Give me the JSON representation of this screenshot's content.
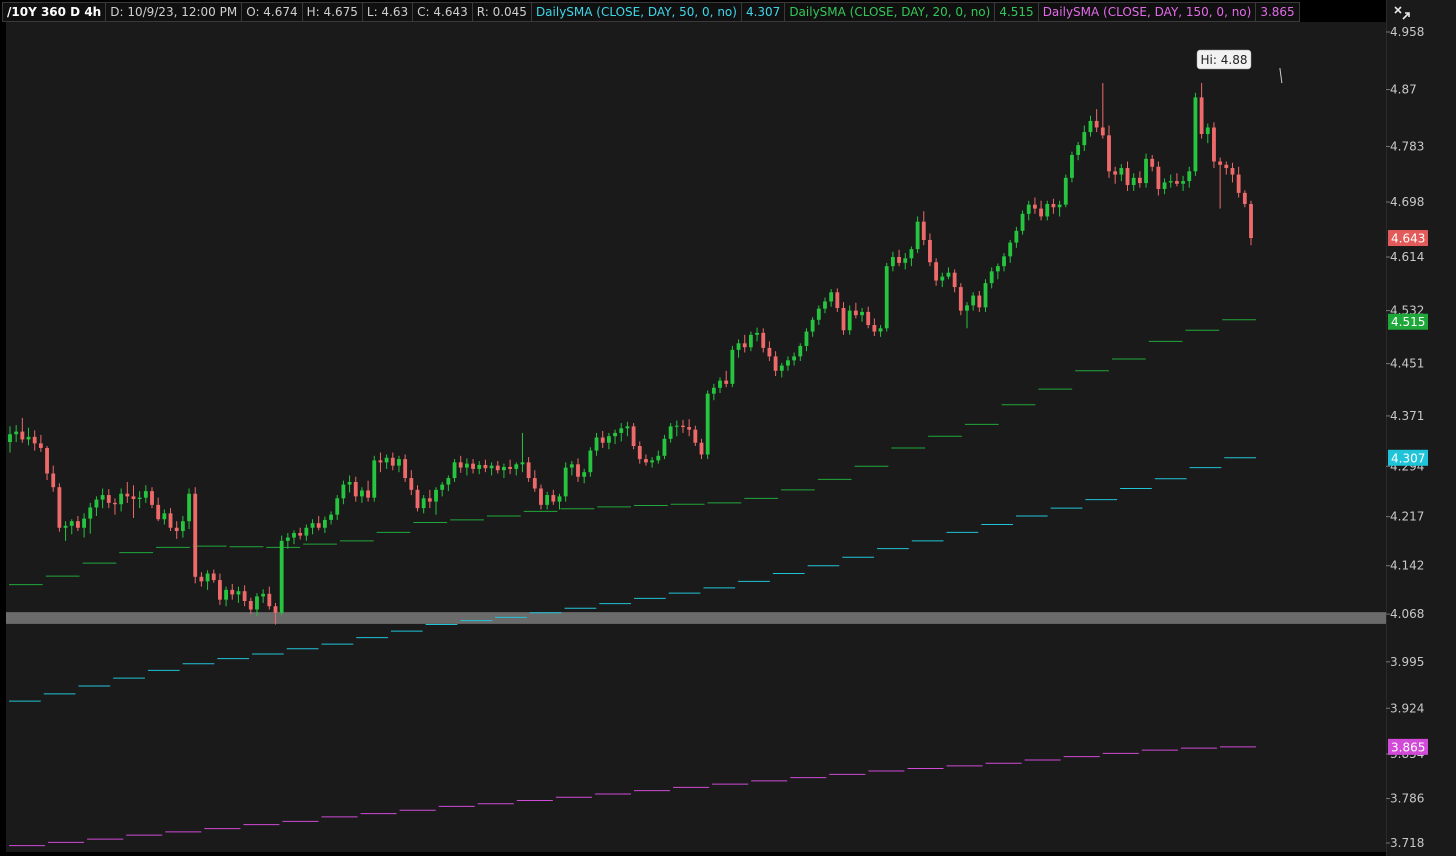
{
  "header": {
    "symbol": "/10Y 360 D 4h",
    "date": "D: 10/9/23, 12:00 PM",
    "open": "O: 4.674",
    "high": "H: 4.675",
    "low": "L: 4.63",
    "close": "C: 4.643",
    "range": "R: 0.045",
    "sma50_label": "DailySMA (CLOSE, DAY, 50, 0, no)",
    "sma50_value": "4.307",
    "sma20_label": "DailySMA (CLOSE, DAY, 20, 0, no)",
    "sma20_value": "4.515",
    "sma150_label": "DailySMA (CLOSE, DAY, 150, 0, no)",
    "sma150_value": "3.865"
  },
  "chart_data": {
    "type": "candlestick",
    "ylim": [
      3.7,
      4.99
    ],
    "y_ticks": [
      "4.958",
      "4.87",
      "4.783",
      "4.698",
      "4.614",
      "4.532",
      "4.451",
      "4.371",
      "4.294",
      "4.217",
      "4.142",
      "4.068",
      "3.995",
      "3.924",
      "3.854",
      "3.786",
      "3.718"
    ],
    "price_tags": [
      {
        "value": 4.643,
        "label": "4.643",
        "color": "#e25a5a"
      },
      {
        "value": 4.515,
        "label": "4.515",
        "color": "#1fa83a"
      },
      {
        "value": 4.307,
        "label": "4.307",
        "color": "#20c4d8"
      },
      {
        "value": 3.865,
        "label": "3.865",
        "color": "#d24ad8"
      }
    ],
    "annotation": {
      "text": "Hi: 4.88",
      "value": 4.88,
      "bar": 206
    },
    "support_band": [
      4.053,
      4.071
    ],
    "candles": [
      [
        4.331,
        4.355,
        4.315,
        4.343
      ],
      [
        4.343,
        4.357,
        4.331,
        4.347
      ],
      [
        4.347,
        4.368,
        4.33,
        4.335
      ],
      [
        4.335,
        4.353,
        4.326,
        4.339
      ],
      [
        4.339,
        4.349,
        4.318,
        4.329
      ],
      [
        4.329,
        4.342,
        4.316,
        4.322
      ],
      [
        4.322,
        4.325,
        4.273,
        4.283
      ],
      [
        4.283,
        4.295,
        4.255,
        4.262
      ],
      [
        4.262,
        4.268,
        4.194,
        4.2
      ],
      [
        4.2,
        4.21,
        4.18,
        4.203
      ],
      [
        4.203,
        4.213,
        4.19,
        4.21
      ],
      [
        4.21,
        4.218,
        4.195,
        4.2
      ],
      [
        4.2,
        4.222,
        4.185,
        4.214
      ],
      [
        4.214,
        4.238,
        4.191,
        4.231
      ],
      [
        4.231,
        4.248,
        4.218,
        4.243
      ],
      [
        4.243,
        4.26,
        4.23,
        4.25
      ],
      [
        4.25,
        4.259,
        4.23,
        4.238
      ],
      [
        4.238,
        4.245,
        4.22,
        4.236
      ],
      [
        4.236,
        4.26,
        4.225,
        4.252
      ],
      [
        4.252,
        4.27,
        4.238,
        4.248
      ],
      [
        4.248,
        4.265,
        4.215,
        4.244
      ],
      [
        4.244,
        4.256,
        4.23,
        4.246
      ],
      [
        4.246,
        4.265,
        4.238,
        4.256
      ],
      [
        4.256,
        4.262,
        4.23,
        4.235
      ],
      [
        4.235,
        4.246,
        4.21,
        4.213
      ],
      [
        4.213,
        4.228,
        4.205,
        4.222
      ],
      [
        4.222,
        4.23,
        4.195,
        4.2
      ],
      [
        4.2,
        4.21,
        4.183,
        4.195
      ],
      [
        4.195,
        4.218,
        4.185,
        4.21
      ],
      [
        4.21,
        4.26,
        4.198,
        4.252
      ],
      [
        4.252,
        4.262,
        4.115,
        4.125
      ],
      [
        4.125,
        4.132,
        4.11,
        4.118
      ],
      [
        4.118,
        4.135,
        4.105,
        4.13
      ],
      [
        4.13,
        4.136,
        4.116,
        4.12
      ],
      [
        4.12,
        4.13,
        4.082,
        4.09
      ],
      [
        4.09,
        4.11,
        4.08,
        4.105
      ],
      [
        4.105,
        4.114,
        4.09,
        4.098
      ],
      [
        4.098,
        4.11,
        4.085,
        4.103
      ],
      [
        4.103,
        4.112,
        4.08,
        4.088
      ],
      [
        4.088,
        4.093,
        4.068,
        4.075
      ],
      [
        4.075,
        4.1,
        4.065,
        4.095
      ],
      [
        4.095,
        4.106,
        4.085,
        4.099
      ],
      [
        4.099,
        4.11,
        4.075,
        4.08
      ],
      [
        4.08,
        4.085,
        4.052,
        4.07
      ],
      [
        4.07,
        4.188,
        4.066,
        4.18
      ],
      [
        4.18,
        4.192,
        4.168,
        4.185
      ],
      [
        4.185,
        4.196,
        4.175,
        4.192
      ],
      [
        4.192,
        4.2,
        4.182,
        4.188
      ],
      [
        4.188,
        4.205,
        4.18,
        4.2
      ],
      [
        4.2,
        4.213,
        4.19,
        4.207
      ],
      [
        4.207,
        4.218,
        4.196,
        4.2
      ],
      [
        4.2,
        4.217,
        4.192,
        4.212
      ],
      [
        4.212,
        4.225,
        4.205,
        4.22
      ],
      [
        4.22,
        4.25,
        4.212,
        4.245
      ],
      [
        4.245,
        4.272,
        4.236,
        4.266
      ],
      [
        4.266,
        4.28,
        4.254,
        4.27
      ],
      [
        4.27,
        4.278,
        4.24,
        4.248
      ],
      [
        4.248,
        4.262,
        4.238,
        4.257
      ],
      [
        4.257,
        4.272,
        4.24,
        4.246
      ],
      [
        4.246,
        4.31,
        4.24,
        4.303
      ],
      [
        4.303,
        4.315,
        4.285,
        4.3
      ],
      [
        4.3,
        4.312,
        4.29,
        4.307
      ],
      [
        4.307,
        4.315,
        4.288,
        4.295
      ],
      [
        4.295,
        4.31,
        4.285,
        4.305
      ],
      [
        4.305,
        4.312,
        4.27,
        4.276
      ],
      [
        4.276,
        4.288,
        4.25,
        4.258
      ],
      [
        4.258,
        4.265,
        4.225,
        4.23
      ],
      [
        4.23,
        4.25,
        4.222,
        4.245
      ],
      [
        4.245,
        4.258,
        4.23,
        4.24
      ],
      [
        4.24,
        4.262,
        4.22,
        4.258
      ],
      [
        4.258,
        4.27,
        4.248,
        4.266
      ],
      [
        4.266,
        4.28,
        4.256,
        4.276
      ],
      [
        4.276,
        4.305,
        4.27,
        4.3
      ],
      [
        4.3,
        4.31,
        4.284,
        4.292
      ],
      [
        4.292,
        4.306,
        4.28,
        4.298
      ],
      [
        4.298,
        4.305,
        4.283,
        4.29
      ],
      [
        4.29,
        4.302,
        4.282,
        4.296
      ],
      [
        4.296,
        4.304,
        4.285,
        4.291
      ],
      [
        4.291,
        4.3,
        4.28,
        4.295
      ],
      [
        4.295,
        4.302,
        4.283,
        4.288
      ],
      [
        4.288,
        4.298,
        4.276,
        4.293
      ],
      [
        4.293,
        4.304,
        4.282,
        4.29
      ],
      [
        4.29,
        4.3,
        4.28,
        4.297
      ],
      [
        4.297,
        4.345,
        4.285,
        4.3
      ],
      [
        4.3,
        4.308,
        4.27,
        4.276
      ],
      [
        4.276,
        4.288,
        4.255,
        4.26
      ],
      [
        4.26,
        4.266,
        4.228,
        4.235
      ],
      [
        4.235,
        4.255,
        4.228,
        4.25
      ],
      [
        4.25,
        4.258,
        4.235,
        4.24
      ],
      [
        4.24,
        4.252,
        4.228,
        4.248
      ],
      [
        4.248,
        4.3,
        4.24,
        4.292
      ],
      [
        4.292,
        4.302,
        4.28,
        4.297
      ],
      [
        4.297,
        4.306,
        4.27,
        4.278
      ],
      [
        4.278,
        4.29,
        4.268,
        4.285
      ],
      [
        4.285,
        4.323,
        4.278,
        4.318
      ],
      [
        4.318,
        4.345,
        4.31,
        4.338
      ],
      [
        4.338,
        4.348,
        4.322,
        4.33
      ],
      [
        4.33,
        4.345,
        4.32,
        4.34
      ],
      [
        4.34,
        4.35,
        4.328,
        4.345
      ],
      [
        4.345,
        4.36,
        4.332,
        4.352
      ],
      [
        4.352,
        4.362,
        4.34,
        4.355
      ],
      [
        4.355,
        4.36,
        4.32,
        4.325
      ],
      [
        4.325,
        4.332,
        4.298,
        4.305
      ],
      [
        4.305,
        4.312,
        4.295,
        4.3
      ],
      [
        4.3,
        4.308,
        4.292,
        4.303
      ],
      [
        4.303,
        4.318,
        4.298,
        4.31
      ],
      [
        4.31,
        4.342,
        4.305,
        4.336
      ],
      [
        4.336,
        4.36,
        4.33,
        4.355
      ],
      [
        4.355,
        4.364,
        4.34,
        4.356
      ],
      [
        4.356,
        4.365,
        4.345,
        4.354
      ],
      [
        4.354,
        4.366,
        4.34,
        4.35
      ],
      [
        4.35,
        4.356,
        4.325,
        4.33
      ],
      [
        4.33,
        4.336,
        4.305,
        4.312
      ],
      [
        4.312,
        4.41,
        4.305,
        4.405
      ],
      [
        4.405,
        4.42,
        4.395,
        4.414
      ],
      [
        4.414,
        4.43,
        4.406,
        4.425
      ],
      [
        4.425,
        4.44,
        4.415,
        4.42
      ],
      [
        4.42,
        4.478,
        4.415,
        4.472
      ],
      [
        4.472,
        4.488,
        4.46,
        4.482
      ],
      [
        4.482,
        4.495,
        4.468,
        4.476
      ],
      [
        4.476,
        4.5,
        4.47,
        4.495
      ],
      [
        4.495,
        4.506,
        4.485,
        4.498
      ],
      [
        4.498,
        4.505,
        4.468,
        4.475
      ],
      [
        4.475,
        4.485,
        4.455,
        4.462
      ],
      [
        4.462,
        4.47,
        4.432,
        4.44
      ],
      [
        4.44,
        4.452,
        4.43,
        4.448
      ],
      [
        4.448,
        4.462,
        4.44,
        4.456
      ],
      [
        4.456,
        4.468,
        4.448,
        4.462
      ],
      [
        4.462,
        4.482,
        4.455,
        4.478
      ],
      [
        4.478,
        4.505,
        4.47,
        4.5
      ],
      [
        4.5,
        4.522,
        4.492,
        4.518
      ],
      [
        4.518,
        4.54,
        4.51,
        4.535
      ],
      [
        4.535,
        4.552,
        4.528,
        4.546
      ],
      [
        4.546,
        4.565,
        4.538,
        4.56
      ],
      [
        4.56,
        4.566,
        4.53,
        4.536
      ],
      [
        4.536,
        4.545,
        4.495,
        4.502
      ],
      [
        4.502,
        4.54,
        4.495,
        4.532
      ],
      [
        4.532,
        4.544,
        4.52,
        4.525
      ],
      [
        4.525,
        4.536,
        4.515,
        4.53
      ],
      [
        4.53,
        4.538,
        4.505,
        4.51
      ],
      [
        4.51,
        4.52,
        4.493,
        4.5
      ],
      [
        4.5,
        4.51,
        4.492,
        4.505
      ],
      [
        4.505,
        4.605,
        4.5,
        4.6
      ],
      [
        4.6,
        4.622,
        4.592,
        4.614
      ],
      [
        4.614,
        4.625,
        4.6,
        4.605
      ],
      [
        4.605,
        4.62,
        4.595,
        4.612
      ],
      [
        4.612,
        4.63,
        4.6,
        4.626
      ],
      [
        4.626,
        4.676,
        4.62,
        4.668
      ],
      [
        4.668,
        4.684,
        4.632,
        4.64
      ],
      [
        4.64,
        4.65,
        4.6,
        4.606
      ],
      [
        4.606,
        4.612,
        4.57,
        4.578
      ],
      [
        4.578,
        4.59,
        4.568,
        4.584
      ],
      [
        4.584,
        4.598,
        4.58,
        4.59
      ],
      [
        4.59,
        4.595,
        4.56,
        4.568
      ],
      [
        4.568,
        4.574,
        4.525,
        4.532
      ],
      [
        4.532,
        4.545,
        4.505,
        4.54
      ],
      [
        4.54,
        4.56,
        4.532,
        4.555
      ],
      [
        4.555,
        4.562,
        4.53,
        4.537
      ],
      [
        4.537,
        4.58,
        4.53,
        4.574
      ],
      [
        4.574,
        4.598,
        4.566,
        4.592
      ],
      [
        4.592,
        4.604,
        4.58,
        4.6
      ],
      [
        4.6,
        4.62,
        4.592,
        4.615
      ],
      [
        4.615,
        4.64,
        4.605,
        4.636
      ],
      [
        4.636,
        4.66,
        4.628,
        4.654
      ],
      [
        4.654,
        4.685,
        4.648,
        4.68
      ],
      [
        4.68,
        4.7,
        4.67,
        4.694
      ],
      [
        4.694,
        4.705,
        4.68,
        4.688
      ],
      [
        4.688,
        4.7,
        4.67,
        4.676
      ],
      [
        4.676,
        4.7,
        4.67,
        4.695
      ],
      [
        4.695,
        4.703,
        4.68,
        4.69
      ],
      [
        4.69,
        4.7,
        4.676,
        4.694
      ],
      [
        4.694,
        4.74,
        4.69,
        4.735
      ],
      [
        4.735,
        4.775,
        4.728,
        4.77
      ],
      [
        4.77,
        4.79,
        4.762,
        4.785
      ],
      [
        4.785,
        4.815,
        4.776,
        4.805
      ],
      [
        4.805,
        4.83,
        4.798,
        4.822
      ],
      [
        4.822,
        4.84,
        4.805,
        4.812
      ],
      [
        4.812,
        4.88,
        4.795,
        4.8
      ],
      [
        4.8,
        4.815,
        4.735,
        4.745
      ],
      [
        4.745,
        4.752,
        4.726,
        4.74
      ],
      [
        4.74,
        4.756,
        4.73,
        4.75
      ],
      [
        4.75,
        4.76,
        4.715,
        4.724
      ],
      [
        4.724,
        4.742,
        4.715,
        4.735
      ],
      [
        4.735,
        4.745,
        4.72,
        4.727
      ],
      [
        4.727,
        4.772,
        4.72,
        4.764
      ],
      [
        4.764,
        4.77,
        4.745,
        4.752
      ],
      [
        4.752,
        4.76,
        4.708,
        4.718
      ],
      [
        4.718,
        4.734,
        4.71,
        4.728
      ],
      [
        4.728,
        4.74,
        4.72,
        4.73
      ],
      [
        4.73,
        4.742,
        4.722,
        4.726
      ],
      [
        4.726,
        4.738,
        4.715,
        4.73
      ],
      [
        4.73,
        4.752,
        4.72,
        4.745
      ],
      [
        4.745,
        4.865,
        4.738,
        4.858
      ],
      [
        4.858,
        4.88,
        4.795,
        4.802
      ],
      [
        4.802,
        4.818,
        4.788,
        4.812
      ],
      [
        4.812,
        4.82,
        4.75,
        4.76
      ],
      [
        4.76,
        4.766,
        4.688,
        4.755
      ],
      [
        4.755,
        4.76,
        4.74,
        4.75
      ],
      [
        4.75,
        4.758,
        4.728,
        4.74
      ],
      [
        4.74,
        4.752,
        4.705,
        4.712
      ],
      [
        4.712,
        4.716,
        4.69,
        4.695
      ],
      [
        4.695,
        4.7,
        4.632,
        4.643
      ]
    ],
    "sma_series": [
      {
        "name": "DailySMA (CLOSE, DAY, 20, 0, no)",
        "color": "#1fa83a",
        "values": [
          4.113,
          4.126,
          4.146,
          4.162,
          4.17,
          4.172,
          4.171,
          4.17,
          4.175,
          4.18,
          4.193,
          4.208,
          4.212,
          4.218,
          4.225,
          4.229,
          4.232,
          4.234,
          4.236,
          4.238,
          4.245,
          4.258,
          4.274,
          4.294,
          4.322,
          4.34,
          4.358,
          4.388,
          4.412,
          4.44,
          4.458,
          4.485,
          4.502,
          4.518
        ]
      },
      {
        "name": "DailySMA (CLOSE, DAY, 50, 0, no)",
        "color": "#20c4d8",
        "values": [
          3.935,
          3.946,
          3.958,
          3.97,
          3.982,
          3.992,
          4.0,
          4.007,
          4.015,
          4.022,
          4.032,
          4.042,
          4.052,
          4.058,
          4.063,
          4.07,
          4.077,
          4.084,
          4.092,
          4.1,
          4.108,
          4.118,
          4.13,
          4.142,
          4.155,
          4.168,
          4.18,
          4.193,
          4.205,
          4.218,
          4.23,
          4.243,
          4.26,
          4.275,
          4.292,
          4.307
        ]
      },
      {
        "name": "DailySMA (CLOSE, DAY, 150, 0, no)",
        "color": "#d24ad8",
        "values": [
          3.714,
          3.719,
          3.724,
          3.73,
          3.735,
          3.74,
          3.746,
          3.751,
          3.758,
          3.763,
          3.768,
          3.774,
          3.778,
          3.783,
          3.788,
          3.793,
          3.798,
          3.803,
          3.808,
          3.813,
          3.818,
          3.823,
          3.828,
          3.832,
          3.836,
          3.84,
          3.845,
          3.85,
          3.855,
          3.86,
          3.863,
          3.865
        ]
      }
    ]
  }
}
